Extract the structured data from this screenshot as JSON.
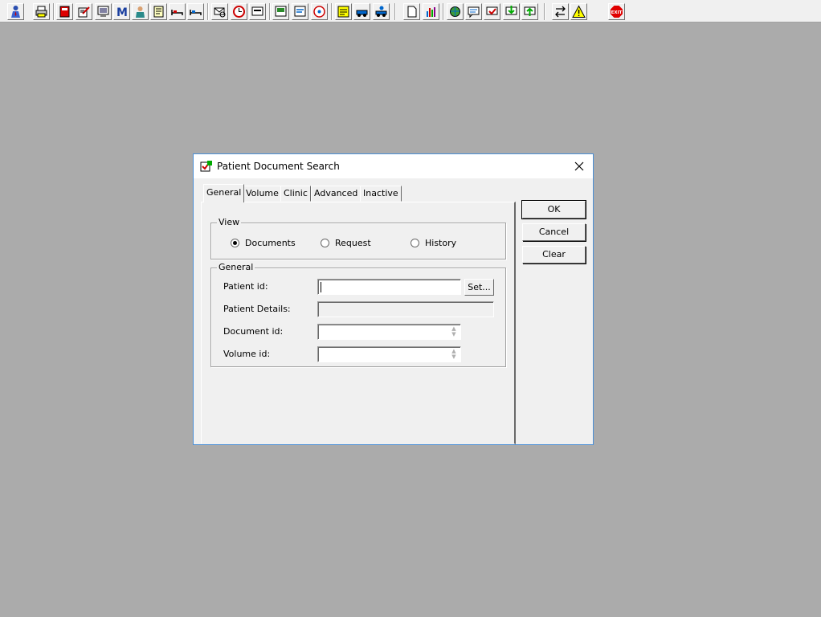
{
  "toolbar": {
    "icons": [
      "person-icon",
      "printer-icon",
      "book-icon",
      "edit-document-icon",
      "monitor-list-icon",
      "m-letter-icon",
      "doctor-icon",
      "notes-icon",
      "bed-icon",
      "bed-alt-icon",
      "envelope-search-icon",
      "clock-icon",
      "display-icon",
      "report-icon",
      "chat-report-icon",
      "disc-icon",
      "sticky-note-icon",
      "transport-icon",
      "transport-person-icon",
      "blank-document-icon",
      "bar-chart-icon",
      "globe-icon",
      "message-icon",
      "message-check-icon",
      "message-download-icon",
      "message-upload-icon",
      "swap-arrows-icon",
      "warning-icon",
      "exit-icon"
    ],
    "exit_label": "EXIT"
  },
  "dialog": {
    "title": "Patient Document Search",
    "tabs": [
      "General",
      "Volume",
      "Clinic",
      "Advanced",
      "Inactive"
    ],
    "active_tab": "General",
    "view_group": {
      "label": "View",
      "options": [
        {
          "label": "Documents",
          "checked": true
        },
        {
          "label": "Request",
          "checked": false
        },
        {
          "label": "History",
          "checked": false
        }
      ]
    },
    "general_group": {
      "label": "General",
      "patient_id_label": "Patient id:",
      "patient_id_value": "",
      "set_button": "Set...",
      "patient_details_label": "Patient Details:",
      "document_id_label": "Document id:",
      "volume_id_label": "Volume id:"
    },
    "buttons": {
      "ok": "OK",
      "cancel": "Cancel",
      "clear": "Clear"
    }
  },
  "colors": {
    "desktop": "#ababab",
    "dialog_border": "#4a8fd6",
    "face": "#f0f0f0"
  }
}
